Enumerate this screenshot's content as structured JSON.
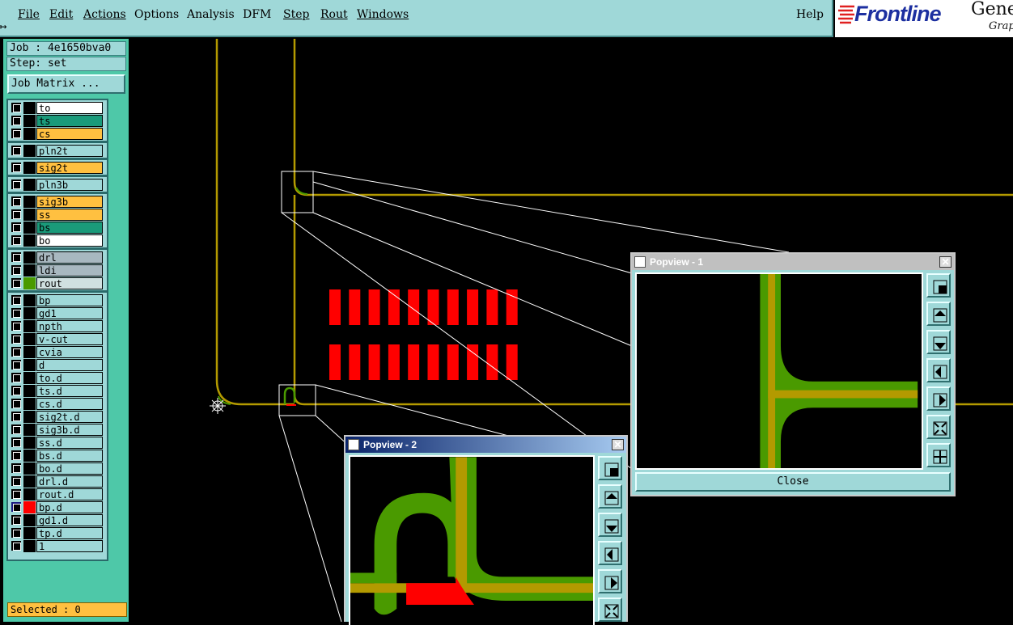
{
  "menu": {
    "items": [
      "File",
      "Edit",
      "Actions",
      "Options",
      "Analysis",
      "DFM",
      "Step",
      "Rout",
      "Windows"
    ],
    "help": "Help"
  },
  "brand": {
    "logo": "Frontline",
    "product": "Gene",
    "sub": "Grap"
  },
  "job": {
    "job_label": "Job : 4e1650bva0",
    "step_label": "Step: set",
    "matrix_button": "Job Matrix ..."
  },
  "layers": [
    {
      "name": "to",
      "color": "#ffffff"
    },
    {
      "name": "ts",
      "color": "#1a9a7a"
    },
    {
      "name": "cs",
      "color": "#ffc040"
    },
    {
      "name": "pln2t",
      "color": "#9fd8d8"
    },
    {
      "name": "sig2t",
      "color": "#ffc040"
    },
    {
      "name": "pln3b",
      "color": "#9fd8d8"
    },
    {
      "name": "sig3b",
      "color": "#ffc040"
    },
    {
      "name": "ss",
      "color": "#ffc040"
    },
    {
      "name": "bs",
      "color": "#1a9a7a"
    },
    {
      "name": "bo",
      "color": "#ffffff"
    },
    {
      "name": "drl",
      "color": "#a8b8c0"
    },
    {
      "name": "ldi",
      "color": "#a8b8c0"
    },
    {
      "name": "rout",
      "color": "#d0e0e0",
      "swatch": "#4a9a00"
    },
    {
      "name": "bp",
      "color": "#9fd8d8"
    },
    {
      "name": "gd1",
      "color": "#9fd8d8"
    },
    {
      "name": "npth",
      "color": "#9fd8d8"
    },
    {
      "name": "v-cut",
      "color": "#9fd8d8"
    },
    {
      "name": "cvia",
      "color": "#9fd8d8"
    },
    {
      "name": "d",
      "color": "#9fd8d8"
    },
    {
      "name": "to.d",
      "color": "#9fd8d8"
    },
    {
      "name": "ts.d",
      "color": "#9fd8d8"
    },
    {
      "name": "cs.d",
      "color": "#9fd8d8"
    },
    {
      "name": "sig2t.d",
      "color": "#9fd8d8"
    },
    {
      "name": "sig3b.d",
      "color": "#9fd8d8"
    },
    {
      "name": "ss.d",
      "color": "#9fd8d8"
    },
    {
      "name": "bs.d",
      "color": "#9fd8d8"
    },
    {
      "name": "bo.d",
      "color": "#9fd8d8"
    },
    {
      "name": "drl.d",
      "color": "#9fd8d8"
    },
    {
      "name": "rout.d",
      "color": "#9fd8d8"
    },
    {
      "name": "bp.d",
      "color": "#9fd8d8",
      "swatch": "#ff0000",
      "checked": true
    },
    {
      "name": "gd1.d",
      "color": "#9fd8d8"
    },
    {
      "name": "tp.d",
      "color": "#9fd8d8"
    },
    {
      "name": "1",
      "color": "#9fd8d8"
    }
  ],
  "status": {
    "selected": "Selected : 0"
  },
  "popview1": {
    "title": "Popview - 1",
    "close_button": "Close"
  },
  "popview2": {
    "title": "Popview - 2"
  },
  "colors": {
    "trace": "#b39a00",
    "rout": "#4a9a00",
    "pad": "#ff0000",
    "panel": "#4ec8a8",
    "widget": "#9fd8d8"
  }
}
